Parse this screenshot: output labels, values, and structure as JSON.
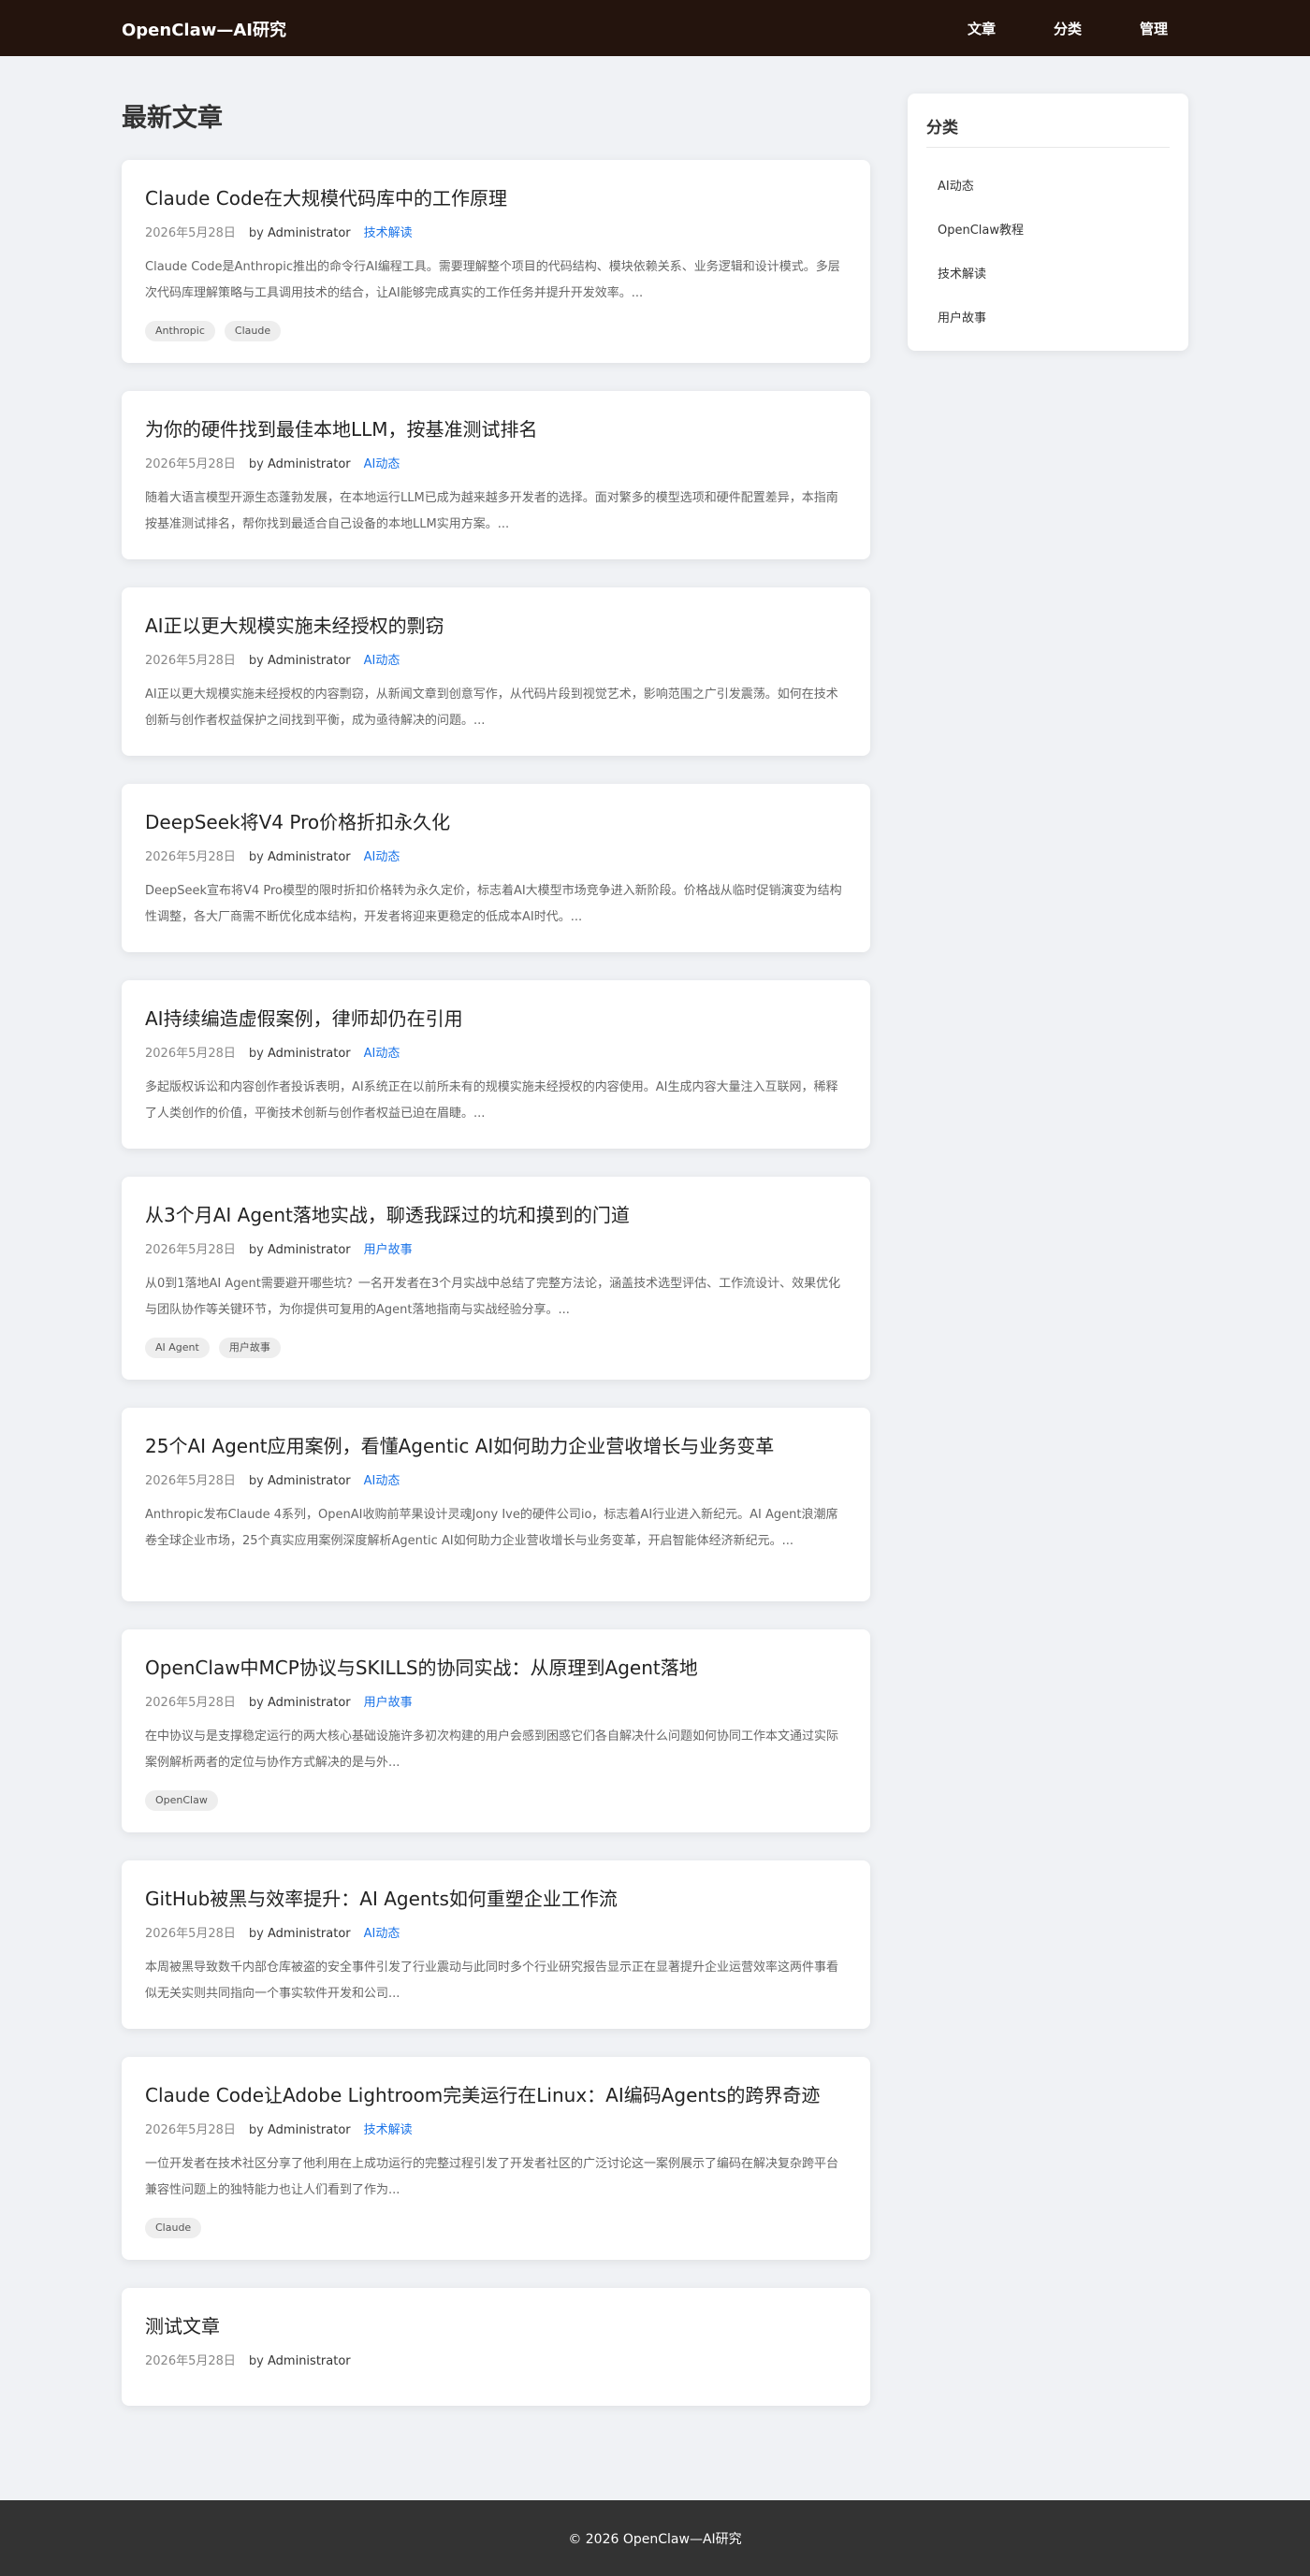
{
  "header": {
    "brand": "OpenClaw—AI研究",
    "nav": [
      {
        "label": "文章"
      },
      {
        "label": "分类"
      },
      {
        "label": "管理"
      }
    ]
  },
  "main": {
    "section_title": "最新文章",
    "posts": [
      {
        "title": "Claude Code在大规模代码库中的工作原理",
        "date": "2026年5月28日",
        "by": "by",
        "author": "Administrator",
        "category": "技术解读",
        "excerpt": "Claude Code是Anthropic推出的命令行AI编程工具。需要理解整个项目的代码结构、模块依赖关系、业务逻辑和设计模式。多层次代码库理解策略与工具调用技术的结合，让AI能够完成真实的工作任务并提升开发效率。...",
        "tags": [
          "Anthropic",
          "Claude"
        ]
      },
      {
        "title": "为你的硬件找到最佳本地LLM，按基准测试排名",
        "date": "2026年5月28日",
        "by": "by",
        "author": "Administrator",
        "category": "AI动态",
        "excerpt": "随着大语言模型开源生态蓬勃发展，在本地运行LLM已成为越来越多开发者的选择。面对繁多的模型选项和硬件配置差异，本指南按基准测试排名，帮你找到最适合自己设备的本地LLM实用方案。...",
        "tags": []
      },
      {
        "title": "AI正以更大规模实施未经授权的剽窃",
        "date": "2026年5月28日",
        "by": "by",
        "author": "Administrator",
        "category": "AI动态",
        "excerpt": "AI正以更大规模实施未经授权的内容剽窃，从新闻文章到创意写作，从代码片段到视觉艺术，影响范围之广引发震荡。如何在技术创新与创作者权益保护之间找到平衡，成为亟待解决的问题。...",
        "tags": []
      },
      {
        "title": "DeepSeek将V4 Pro价格折扣永久化",
        "date": "2026年5月28日",
        "by": "by",
        "author": "Administrator",
        "category": "AI动态",
        "excerpt": "DeepSeek宣布将V4 Pro模型的限时折扣价格转为永久定价，标志着AI大模型市场竞争进入新阶段。价格战从临时促销演变为结构性调整，各大厂商需不断优化成本结构，开发者将迎来更稳定的低成本AI时代。...",
        "tags": []
      },
      {
        "title": "AI持续编造虚假案例，律师却仍在引用",
        "date": "2026年5月28日",
        "by": "by",
        "author": "Administrator",
        "category": "AI动态",
        "excerpt": "多起版权诉讼和内容创作者投诉表明，AI系统正在以前所未有的规模实施未经授权的内容使用。AI生成内容大量注入互联网，稀释了人类创作的价值，平衡技术创新与创作者权益已迫在眉睫。...",
        "tags": []
      },
      {
        "title": "从3个月AI Agent落地实战，聊透我踩过的坑和摸到的门道",
        "date": "2026年5月28日",
        "by": "by",
        "author": "Administrator",
        "category": "用户故事",
        "excerpt": "从0到1落地AI Agent需要避开哪些坑？一名开发者在3个月实战中总结了完整方法论，涵盖技术选型评估、工作流设计、效果优化与团队协作等关键环节，为你提供可复用的Agent落地指南与实战经验分享。...",
        "tags": [
          "AI Agent",
          "用户故事"
        ]
      },
      {
        "title": "25个AI Agent应用案例，看懂Agentic AI如何助力企业营收增长与业务变革",
        "date": "2026年5月28日",
        "by": "by",
        "author": "Administrator",
        "category": "AI动态",
        "excerpt": "Anthropic发布Claude 4系列，OpenAI收购前苹果设计灵魂Jony Ive的硬件公司io，标志着AI行业进入新纪元。AI Agent浪潮席卷全球企业市场，25个真实应用案例深度解析Agentic AI如何助力企业营收增长与业务变革，开启智能体经济新纪元。...",
        "tags": []
      },
      {
        "title": "OpenClaw中MCP协议与SKILLS的协同实战：从原理到Agent落地",
        "date": "2026年5月28日",
        "by": "by",
        "author": "Administrator",
        "category": "用户故事",
        "excerpt": "在中协议与是支撑稳定运行的两大核心基础设施许多初次构建的用户会感到困惑它们各自解决什么问题如何协同工作本文通过实际案例解析两者的定位与协作方式解决的是与外...",
        "tags": [
          "OpenClaw"
        ]
      },
      {
        "title": "GitHub被黑与效率提升：AI Agents如何重塑企业工作流",
        "date": "2026年5月28日",
        "by": "by",
        "author": "Administrator",
        "category": "AI动态",
        "excerpt": "本周被黑导致数千内部仓库被盗的安全事件引发了行业震动与此同时多个行业研究报告显示正在显著提升企业运营效率这两件事看似无关实则共同指向一个事实软件开发和公司...",
        "tags": []
      },
      {
        "title": "Claude Code让Adobe Lightroom完美运行在Linux：AI编码Agents的跨界奇迹",
        "date": "2026年5月28日",
        "by": "by",
        "author": "Administrator",
        "category": "技术解读",
        "excerpt": "一位开发者在技术社区分享了他利用在上成功运行的完整过程引发了开发者社区的广泛讨论这一案例展示了编码在解决复杂跨平台兼容性问题上的独特能力也让人们看到了作为...",
        "tags": [
          "Claude"
        ]
      },
      {
        "title": "测试文章",
        "date": "2026年5月28日",
        "by": "by",
        "author": "Administrator",
        "category": "",
        "excerpt": "",
        "tags": []
      }
    ]
  },
  "sidebar": {
    "title": "分类",
    "items": [
      {
        "label": "AI动态"
      },
      {
        "label": "OpenClaw教程"
      },
      {
        "label": "技术解读"
      },
      {
        "label": "用户故事"
      }
    ]
  },
  "footer": {
    "text": "© 2026 OpenClaw—AI研究"
  },
  "colors": {
    "header_bg": "#24140d",
    "page_bg": "#f0f2f5",
    "category_link": "#1a73e8",
    "footer_bg": "#333333"
  }
}
